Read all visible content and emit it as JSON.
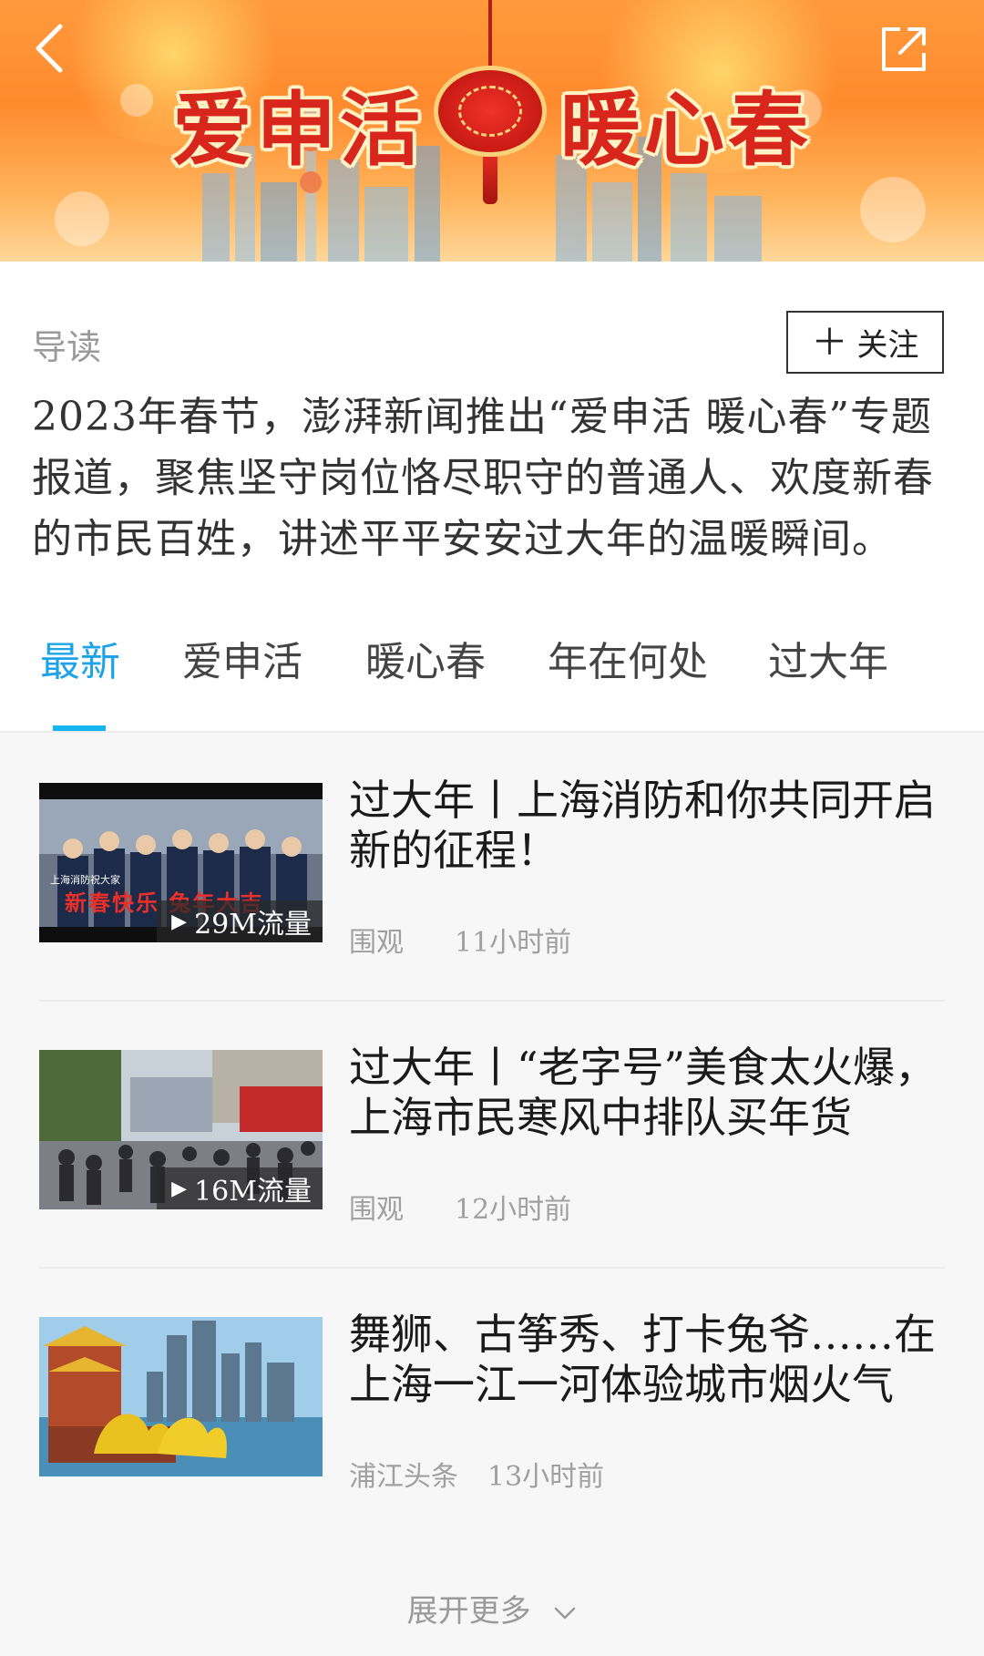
{
  "banner": {
    "title_left": "爱申活",
    "title_right": "暖心春"
  },
  "intro": {
    "label": "导读",
    "follow_label": "关注",
    "text": "2023年春节，澎湃新闻推出“爱申活 暖心春”专题报道，聚焦坚守岗位恪尽职守的普通人、欢度新春的市民百姓，讲述平平安安过大年的温暖瞬间。"
  },
  "tabs": [
    {
      "label": "最新",
      "active": true
    },
    {
      "label": "爱申活",
      "active": false
    },
    {
      "label": "暖心春",
      "active": false
    },
    {
      "label": "年在何处",
      "active": false
    },
    {
      "label": "过大年",
      "active": false
    }
  ],
  "items": [
    {
      "title": "过大年丨上海消防和你共同开启新的征程！",
      "thumb_caption": "上海消防祝大家",
      "thumb_slogan": "新春快乐 兔年大吉",
      "badge": "29M流量",
      "source": "围观",
      "time": "11小时前"
    },
    {
      "title": "过大年丨“老字号”美食太火爆，上海市民寒风中排队买年货",
      "badge": "16M流量",
      "source": "围观",
      "time": "12小时前"
    },
    {
      "title": "舞狮、古筝秀、打卡兔爷……在上海一江一河体验城市烟火气",
      "source": "浦江头条",
      "time": "13小时前"
    }
  ],
  "more_label": "展开更多",
  "colors": {
    "accent": "#1ea3e8",
    "banner": "#ff8a2e",
    "title_red": "#d8261c"
  }
}
